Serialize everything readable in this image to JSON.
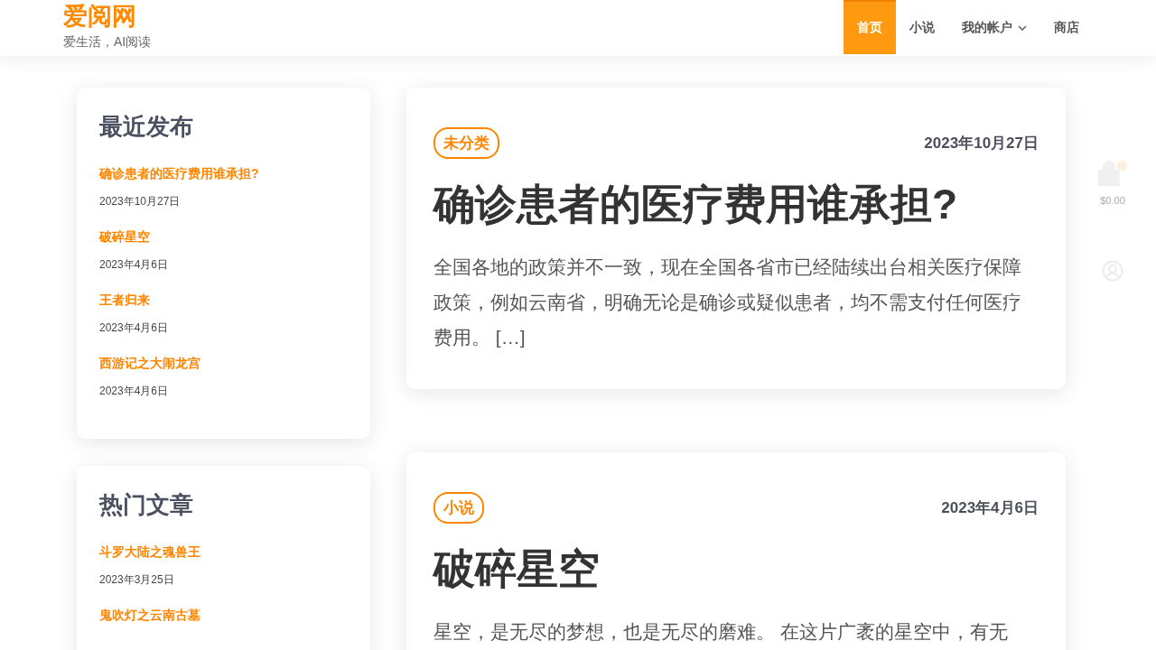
{
  "site": {
    "title": "爱阅网",
    "tagline": "爱生活，AI阅读"
  },
  "nav": [
    {
      "label": "首页",
      "selected": true,
      "dropdown": false
    },
    {
      "label": "小说",
      "selected": false,
      "dropdown": false
    },
    {
      "label": "我的帐户",
      "selected": false,
      "dropdown": true
    },
    {
      "label": "商店",
      "selected": false,
      "dropdown": false
    }
  ],
  "widgets": [
    {
      "title": "最近发布",
      "posts": [
        {
          "title": "确诊患者的医疗费用谁承担?",
          "date": "2023年10月27日"
        },
        {
          "title": "破碎星空",
          "date": "2023年4月6日"
        },
        {
          "title": "王者归来",
          "date": "2023年4月6日"
        },
        {
          "title": "西游记之大闹龙宫",
          "date": "2023年4月6日"
        }
      ]
    },
    {
      "title": "热门文章",
      "posts": [
        {
          "title": "斗罗大陆之魂兽王",
          "date": "2023年3月25日"
        },
        {
          "title": "鬼吹灯之云南古墓"
        }
      ]
    }
  ],
  "articles": [
    {
      "category": "未分类",
      "date": "2023年10月27日",
      "title": "确诊患者的医疗费用谁承担?",
      "excerpt": "全国各地的政策并不一致，现在全国各省市已经陆续出台相关医疗保障政策，例如云南省，明确无论是确诊或疑似患者，均不需支付任何医疗费用。 […]"
    },
    {
      "category": "小说",
      "date": "2023年4月6日",
      "title": "破碎星空",
      "excerpt": "星空，是无尽的梦想，也是无尽的磨难。 在这片广袤的星空中，有无"
    }
  ],
  "cart": {
    "total": "$0.00"
  }
}
